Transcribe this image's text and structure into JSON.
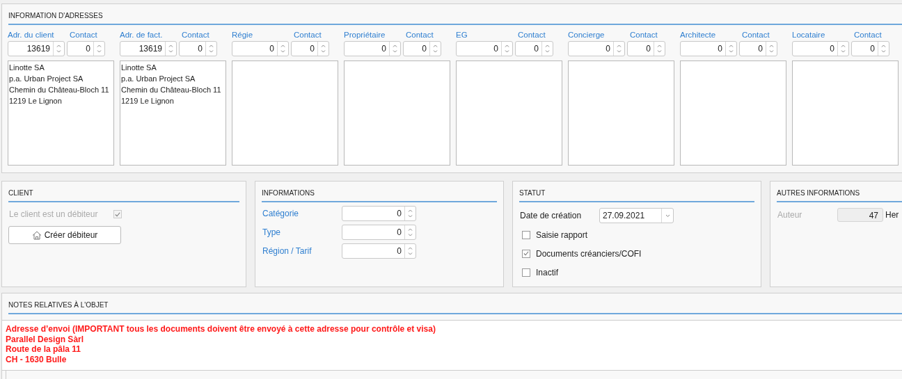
{
  "addresses": {
    "title": "INFORMATION D'ADRESSES",
    "columns": [
      {
        "label": "Adr. du client",
        "value": "13619",
        "contact_label": "Contact",
        "contact_value": "0",
        "address_lines": [
          "Linotte SA",
          "p.a. Urban Project SA",
          "Chemin du Château-Bloch 11",
          "1219 Le Lignon"
        ]
      },
      {
        "label": "Adr. de fact.",
        "value": "13619",
        "contact_label": "Contact",
        "contact_value": "0",
        "address_lines": [
          "Linotte SA",
          "p.a. Urban Project SA",
          "Chemin du Château-Bloch 11",
          "1219 Le Lignon"
        ]
      },
      {
        "label": "Régie",
        "value": "0",
        "contact_label": "Contact",
        "contact_value": "0"
      },
      {
        "label": "Propriétaire",
        "value": "0",
        "contact_label": "Contact",
        "contact_value": "0"
      },
      {
        "label": "EG",
        "value": "0",
        "contact_label": "Contact",
        "contact_value": "0"
      },
      {
        "label": "Concierge",
        "value": "0",
        "contact_label": "Contact",
        "contact_value": "0"
      },
      {
        "label": "Architecte",
        "value": "0",
        "contact_label": "Contact",
        "contact_value": "0"
      },
      {
        "label": "Locataire",
        "value": "0",
        "contact_label": "Contact",
        "contact_value": "0"
      }
    ]
  },
  "client": {
    "title": "CLIENT",
    "debtor": {
      "label": "Le client est un débiteur",
      "checked": true,
      "disabled": true
    },
    "create_button": "Créer débiteur"
  },
  "informations": {
    "title": "INFORMATIONS",
    "fields": [
      {
        "label": "Catégorie",
        "value": "0"
      },
      {
        "label": "Type",
        "value": "0"
      },
      {
        "label": "Région / Tarif",
        "value": "0"
      }
    ]
  },
  "statut": {
    "title": "STATUT",
    "date": {
      "label": "Date de création",
      "value": "27.09.2021"
    },
    "checkboxes": [
      {
        "label": "Saisie rapport",
        "checked": false
      },
      {
        "label": "Documents créanciers/COFI",
        "checked": true
      },
      {
        "label": "Inactif",
        "checked": false
      }
    ]
  },
  "autres": {
    "title": "AUTRES INFORMATIONS",
    "fields": [
      {
        "label": "Auteur",
        "value": "47",
        "suffix": "Her"
      }
    ]
  },
  "notes": {
    "title": "NOTES RELATIVES À L'OBJET",
    "lines": [
      "Adresse d’envoi (IMPORTANT tous les documents doivent être envoyé à cette adresse pour contrôle et visa)",
      "Parallel Design Sàrl",
      "Route de la pâla 11",
      "CH - 1630 Bulle"
    ]
  }
}
